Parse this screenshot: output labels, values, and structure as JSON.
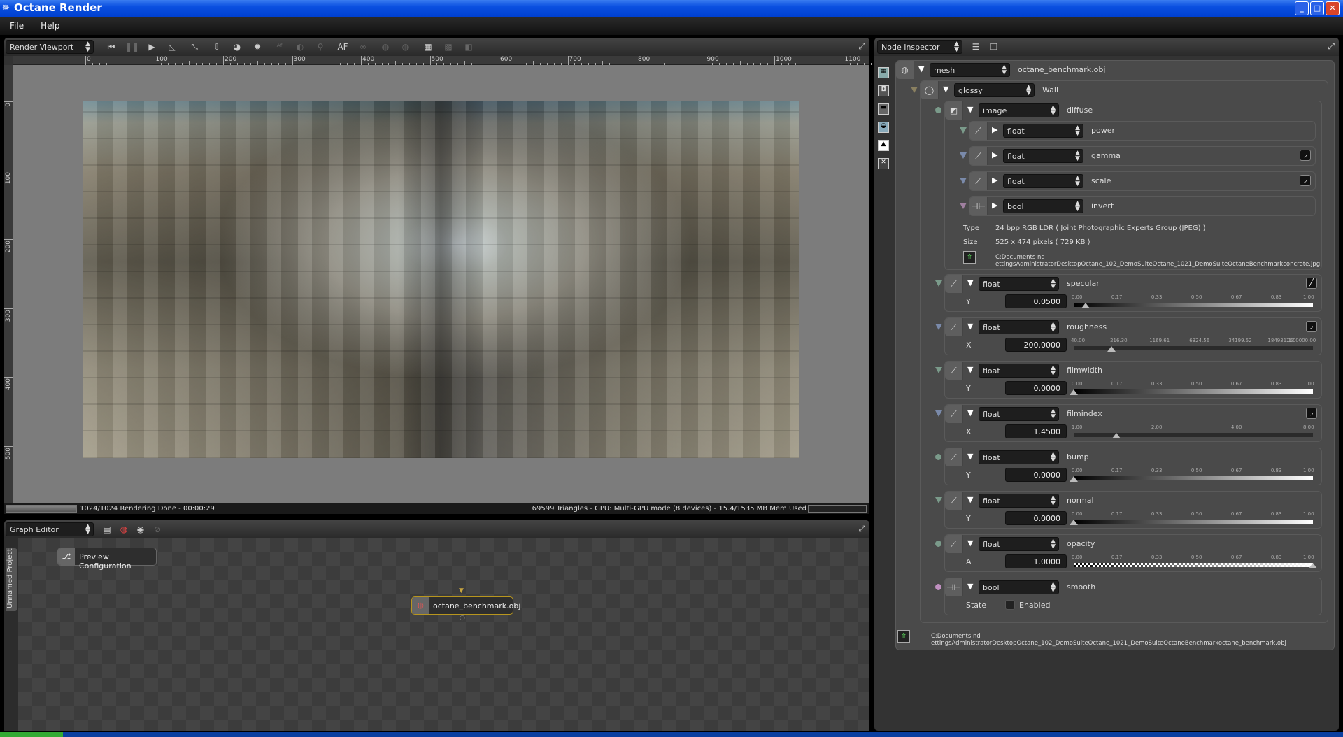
{
  "window": {
    "title": "Octane Render",
    "min": "_",
    "max": "□",
    "close": "✕"
  },
  "menu": [
    "File",
    "Help"
  ],
  "viewport": {
    "panel_combo": "Render Viewport",
    "toolbar_icons": [
      "restart-icon",
      "pause-icon",
      "play-icon",
      "focus-picker-icon",
      "recenter-icon",
      "save-render-icon",
      "material-picker-icon",
      "light-icon",
      "autofocus-picker-icon",
      "white-balance-icon",
      "zoom-picker-icon",
      "af-icon",
      "stereo-icon",
      "lock-icon",
      "unlock-icon",
      "alpha-icon",
      "checker-icon",
      "split-icon"
    ],
    "af_label": "AF",
    "ruler_h": [
      "0",
      "100",
      "200",
      "300",
      "400",
      "500",
      "600",
      "700",
      "800",
      "900",
      "1000",
      "1100"
    ],
    "ruler_v": [
      "0",
      "100",
      "200",
      "300",
      "400",
      "500"
    ],
    "status_left": "1024/1024 Rendering Done - 00:00:29",
    "status_right": "69599 Triangles - GPU: Multi-GPU mode (8 devices) - 15.4/1535 MB Mem Used",
    "render_progress": 1.0
  },
  "graph": {
    "panel_combo": "Graph Editor",
    "tab": "Unnamed Project",
    "nodes": [
      {
        "label": "Preview Configuration",
        "icon": "preview-config-icon"
      },
      {
        "label": "octane_benchmark.obj",
        "icon": "mesh-icon"
      }
    ]
  },
  "inspector": {
    "panel_combo": "Node Inspector",
    "mesh": {
      "type": "mesh",
      "name": "octane_benchmark.obj"
    },
    "material": {
      "type": "glossy",
      "name": "Wall"
    },
    "texture": {
      "type": "image",
      "name": "diffuse",
      "children": [
        {
          "type": "float",
          "name": "power",
          "pin": "#7a9a8a",
          "curve": ""
        },
        {
          "type": "float",
          "name": "gamma",
          "pin": "#7a8aaa",
          "curve": "◞"
        },
        {
          "type": "float",
          "name": "scale",
          "pin": "#7a8aaa",
          "curve": "◞"
        },
        {
          "type": "bool",
          "name": "invert",
          "pin": "#a080a0",
          "curve": ""
        }
      ],
      "type_label": "Type",
      "type_value": "24 bpp RGB LDR ( Joint Photographic Experts Group (JPEG) )",
      "size_label": "Size",
      "size_value": "525 x 474 pixels ( 729 KB )",
      "path": "C:Documents  nd  ettingsAdministratorDesktopOctane_102_DemoSuiteOctane_1021_DemoSuiteOctaneBenchmarkconcrete.jpg"
    },
    "params": [
      {
        "type": "float",
        "name": "specular",
        "pin": "#7a9a8a",
        "pin_shape": "tri",
        "curve": "╱",
        "axis": "Y",
        "value": "0.0500",
        "num": 0.05,
        "scale": "linear",
        "min": 0,
        "max": 1,
        "track": "gray",
        "ticks": [
          "0.00",
          "0.17",
          "0.33",
          "0.50",
          "0.67",
          "0.83",
          "1.00"
        ]
      },
      {
        "type": "float",
        "name": "roughness",
        "pin": "#7a8aaa",
        "pin_shape": "tri",
        "curve": "◞",
        "axis": "X",
        "value": "200.0000",
        "num": 200,
        "scale": "log",
        "min": 40,
        "max": 1000000,
        "track": "dark",
        "ticks": [
          "40.00",
          "216.30",
          "1169.61",
          "6324.56",
          "34199.52",
          "184931.13",
          "1000000.00"
        ]
      },
      {
        "type": "float",
        "name": "filmwidth",
        "pin": "#7a9a8a",
        "pin_shape": "tri",
        "curve": "",
        "axis": "Y",
        "value": "0.0000",
        "num": 0,
        "scale": "linear",
        "min": 0,
        "max": 1,
        "track": "gray",
        "ticks": [
          "0.00",
          "0.17",
          "0.33",
          "0.50",
          "0.67",
          "0.83",
          "1.00"
        ]
      },
      {
        "type": "float",
        "name": "filmindex",
        "pin": "#7a8aaa",
        "pin_shape": "tri",
        "curve": "◞",
        "axis": "X",
        "value": "1.4500",
        "num": 1.45,
        "scale": "log",
        "min": 1,
        "max": 8,
        "track": "dark",
        "ticks": [
          "1.00",
          "2.00",
          "4.00",
          "8.00"
        ]
      },
      {
        "type": "float",
        "name": "bump",
        "pin": "#7a9a8a",
        "pin_shape": "dot",
        "curve": "",
        "axis": "Y",
        "value": "0.0000",
        "num": 0,
        "scale": "linear",
        "min": 0,
        "max": 1,
        "track": "gray",
        "ticks": [
          "0.00",
          "0.17",
          "0.33",
          "0.50",
          "0.67",
          "0.83",
          "1.00"
        ]
      },
      {
        "type": "float",
        "name": "normal",
        "pin": "#7a9a8a",
        "pin_shape": "tri",
        "curve": "",
        "axis": "Y",
        "value": "0.0000",
        "num": 0,
        "scale": "linear",
        "min": 0,
        "max": 1,
        "track": "gray",
        "ticks": [
          "0.00",
          "0.17",
          "0.33",
          "0.50",
          "0.67",
          "0.83",
          "1.00"
        ]
      },
      {
        "type": "float",
        "name": "opacity",
        "pin": "#7a9a8a",
        "pin_shape": "dot",
        "curve": "",
        "axis": "A",
        "value": "1.0000",
        "num": 1,
        "scale": "linear",
        "min": 0,
        "max": 1,
        "track": "checker",
        "ticks": [
          "0.00",
          "0.17",
          "0.33",
          "0.50",
          "0.67",
          "0.83",
          "1.00"
        ]
      },
      {
        "type": "bool",
        "name": "smooth",
        "pin": "#c090c0",
        "pin_shape": "dot",
        "curve": "",
        "axis": "State",
        "checkbox_label": "Enabled",
        "checked": false
      }
    ],
    "mesh_path": "C:Documents  nd  ettingsAdministratorDesktopOctane_102_DemoSuiteOctane_1021_DemoSuiteOctaneBenchmarkoctane_benchmark.obj"
  }
}
